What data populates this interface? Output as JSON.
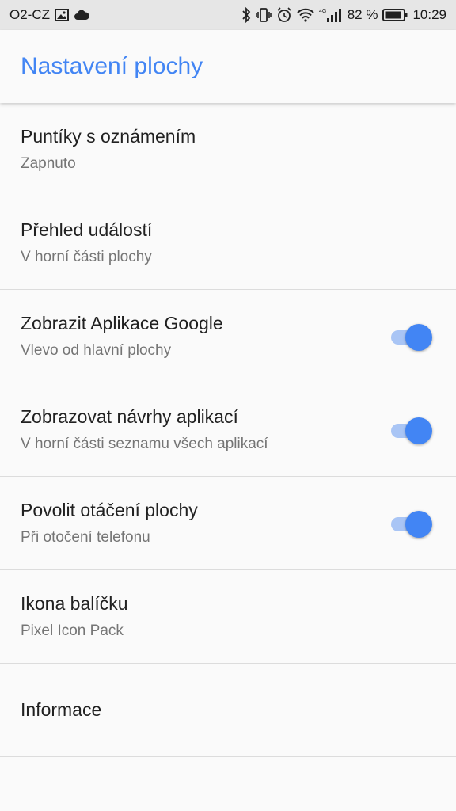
{
  "statusbar": {
    "carrier": "O2-CZ",
    "network_badge": "4G",
    "battery_percent": "82 %",
    "time": "10:29",
    "icons": [
      "image-icon",
      "cloud-icon",
      "bluetooth-icon",
      "vibrate-icon",
      "alarm-icon",
      "wifi-icon",
      "signal-icon",
      "battery-icon"
    ]
  },
  "appbar": {
    "title": "Nastavení plochy"
  },
  "accent_color": "#4285f4",
  "settings": [
    {
      "title": "Puntíky s oznámením",
      "subtitle": "Zapnuto"
    },
    {
      "title": "Přehled událostí",
      "subtitle": "V horní části plochy"
    },
    {
      "title": "Zobrazit Aplikace Google",
      "subtitle": "Vlevo od hlavní plochy",
      "toggle": true
    },
    {
      "title": "Zobrazovat návrhy aplikací",
      "subtitle": "V horní části seznamu všech aplikací",
      "toggle": true
    },
    {
      "title": "Povolit otáčení plochy",
      "subtitle": "Při otočení telefonu",
      "toggle": true
    },
    {
      "title": "Ikona balíčku",
      "subtitle": "Pixel Icon Pack"
    },
    {
      "title": "Informace"
    }
  ]
}
